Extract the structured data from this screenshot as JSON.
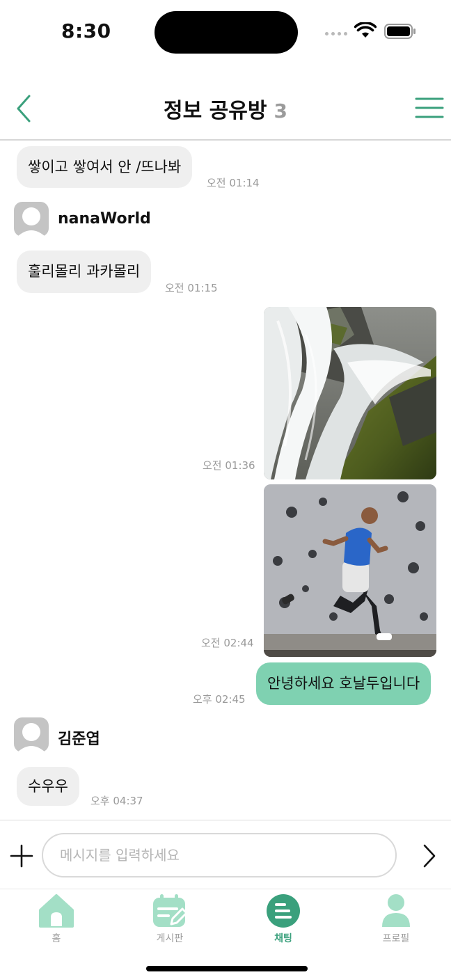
{
  "status_bar": {
    "time": "8:30"
  },
  "header": {
    "title": "정보 공유방",
    "member_count": "3"
  },
  "chat": {
    "m1_text": "쌓이고 쌓여서 안 /뜨나봐",
    "m1_time": "오전 01:14",
    "sender1_name": "nanaWorld",
    "m2_text": "훌리몰리 과카몰리",
    "m2_time": "오전 01:15",
    "m3_time": "오전 01:36",
    "m4_time": "오전 02:44",
    "m5_text": "안녕하세요 호날두입니다",
    "m5_time": "오후 02:45",
    "sender2_name": "김준엽",
    "m6_text": "수우우",
    "m6_time": "오후 04:37"
  },
  "input": {
    "placeholder": "메시지를 입력하세요"
  },
  "tabs": [
    {
      "label": "홈",
      "icon": "home-icon"
    },
    {
      "label": "게시판",
      "icon": "board-icon"
    },
    {
      "label": "채팅",
      "icon": "chat-icon",
      "active": true
    },
    {
      "label": "프로필",
      "icon": "profile-icon"
    }
  ],
  "colors": {
    "accent": "#3aa07c",
    "outgoing_bubble": "#7fd1b1",
    "incoming_bubble": "#efefef",
    "tab_icon_light": "#a3dfc6"
  }
}
